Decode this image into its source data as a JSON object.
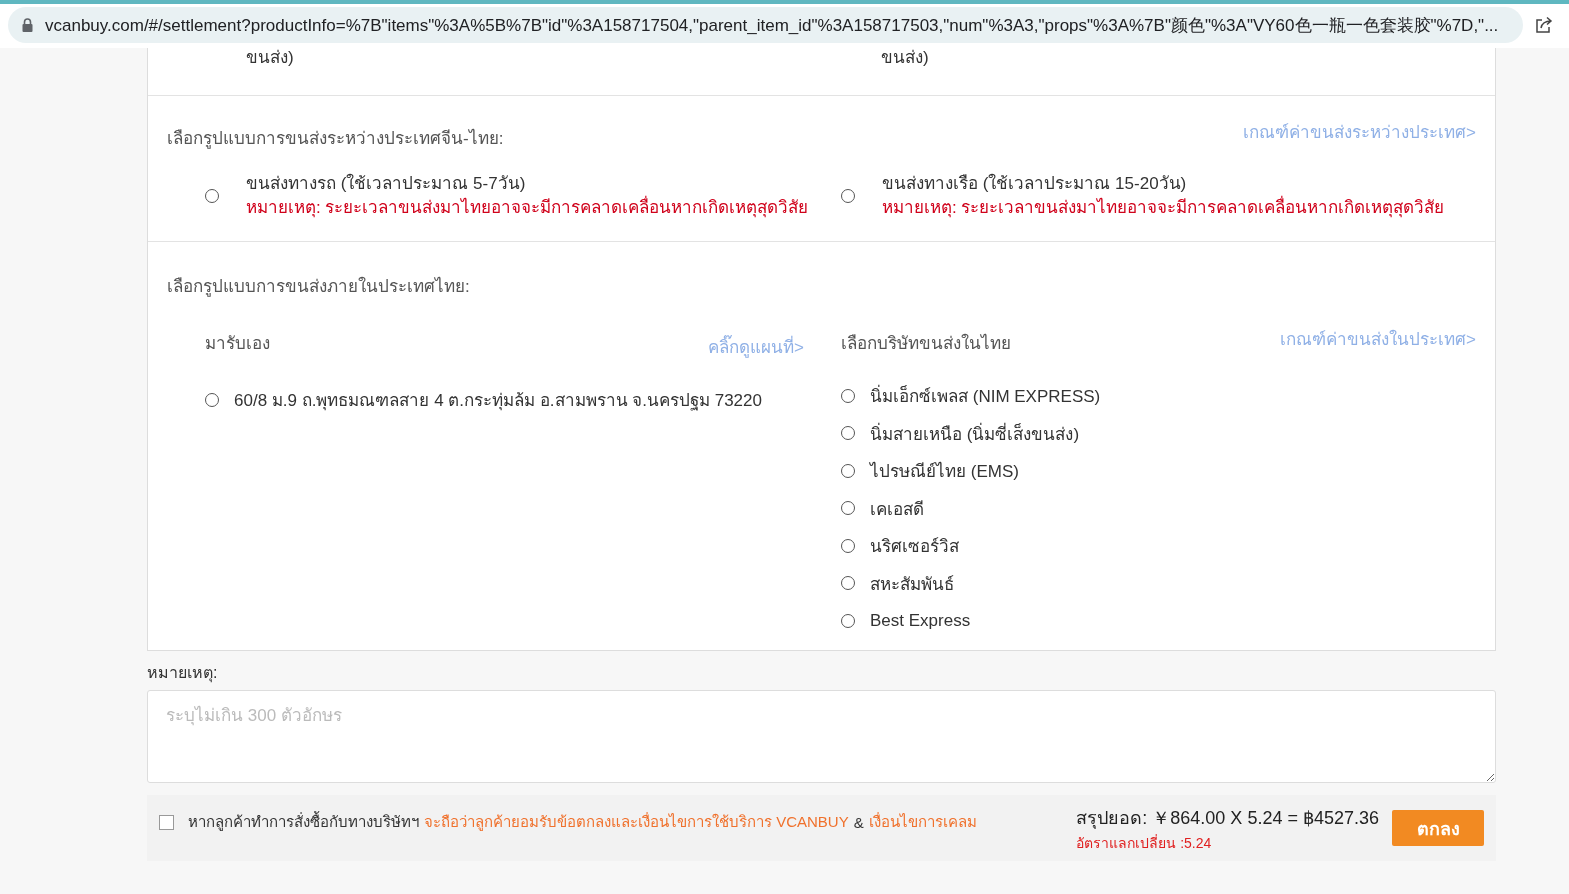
{
  "address_bar": {
    "url": "vcanbuy.com/#/settlement?productInfo=%7B\"items\"%3A%5B%7B\"id\"%3A158717504,\"parent_item_id\"%3A158717503,\"num\"%3A3,\"props\"%3A%7B\"颜色\"%3A\"VY60色一瓶一色套装胶\"%7D,\"..."
  },
  "cut_row": [
    "ขนส่ง)",
    "ขนส่ง)"
  ],
  "international": {
    "heading": "เลือกรูปแบบการขนส่งระหว่างประเทศจีน-ไทย:",
    "link": "เกณฑ์ค่าขนส่งระหว่างประเทศ>",
    "options": [
      {
        "label": "ขนส่งทางรถ (ใช้เวลาประมาณ 5-7วัน)",
        "note": "หมายเหตุ:  ระยะเวลาขนส่งมาไทยอาจจะมีการคลาดเคลื่อนหากเกิดเหตุสุดวิสัย",
        "selected": false
      },
      {
        "label": "ขนส่งทางเรือ (ใช้เวลาประมาณ 15-20วัน)",
        "note": "หมายเหตุ:  ระยะเวลาขนส่งมาไทยอาจจะมีการคลาดเคลื่อนหากเกิดเหตุสุดวิสัย",
        "selected": false
      }
    ]
  },
  "domestic": {
    "heading": "เลือกรูปแบบการขนส่งภายในประเทศไทย:",
    "pickup": {
      "title": "มารับเอง",
      "link": "คลิ๊กดูแผนที่>",
      "options": [
        {
          "label": "60/8 ม.9 ถ.พุทธมณฑลสาย 4 ต.กระทุ่มล้ม อ.สามพราน จ.นครปฐม 73220",
          "selected": false
        }
      ]
    },
    "carriers": {
      "title": "เลือกบริษัทขนส่งในไทย",
      "link": "เกณฑ์ค่าขนส่งในประเทศ>",
      "options": [
        {
          "label": "นิ่มเอ็กซ์เพลส   (NIM EXPRESS)",
          "selected": false
        },
        {
          "label": "นิ่มสายเหนือ  (นิ่มซี่เส็งขนส่ง)",
          "selected": false
        },
        {
          "label": "ไปรษณีย์ไทย (EMS)",
          "selected": false
        },
        {
          "label": "เคเอสดี",
          "selected": false
        },
        {
          "label": "นริศเซอร์วิส",
          "selected": false
        },
        {
          "label": "สหะสัมพันธ์",
          "selected": false
        },
        {
          "label": "Best Express",
          "selected": false
        }
      ]
    }
  },
  "remark": {
    "label": "หมายเหตุ:",
    "placeholder": "ระบุไม่เกิน 300 ตัวอักษร"
  },
  "footer": {
    "agree_checked": false,
    "agree_text": "หากลูกค้าทำการสั่งซื้อกับทางบริษัทฯ",
    "terms_link": "จะถือว่าลูกค้ายอมรับข้อตกลงและเงื่อนไขการใช้บริการ VCANBUY",
    "ampersand": "&",
    "claim_link": "เงื่อนไขการเคลม",
    "total_label": "สรุปยอด:",
    "total": "￥864.00 X 5.24 = ฿4527.36",
    "rate": "อัตราแลกเปลี่ยน :5.24",
    "confirm": "ตกลง"
  }
}
